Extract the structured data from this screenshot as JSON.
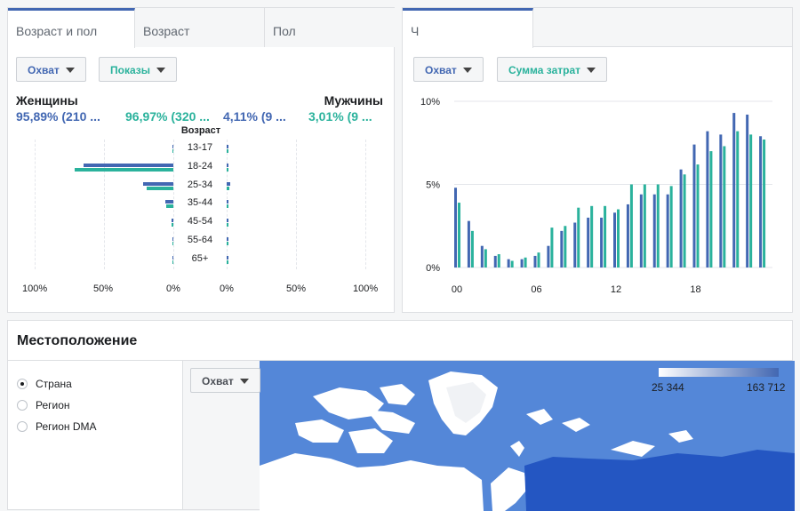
{
  "age_card": {
    "tabs": [
      "Возраст и пол",
      "Возраст",
      "Пол"
    ],
    "metric1": "Охват",
    "metric2": "Показы",
    "women_label": "Женщины",
    "men_label": "Мужчины",
    "women_reach": "95,89% (210 ...",
    "women_impr": "96,97% (320 ...",
    "men_reach": "4,11% (9 ...",
    "men_impr": "3,01% (9 ...",
    "age_header": "Возраст",
    "axis_left": [
      "100%",
      "50%",
      "0%"
    ],
    "axis_right": [
      "0%",
      "50%",
      "100%"
    ]
  },
  "hour_card": {
    "tab": "Ч",
    "metric1": "Охват",
    "metric2": "Сумма затрат",
    "y_ticks": [
      "10%",
      "5%",
      "0%"
    ],
    "x_ticks": [
      "00",
      "06",
      "12",
      "18"
    ]
  },
  "location": {
    "title": "Местоположение",
    "options": [
      "Страна",
      "Регион",
      "Регион DMA"
    ],
    "selected": "Страна",
    "metric": "Охват",
    "legend_min": "25 344",
    "legend_max": "163 712"
  },
  "colors": {
    "reach": "#4267b2",
    "secondary": "#2ab29c"
  },
  "chart_data": [
    {
      "type": "bar",
      "title": "",
      "xlabel": "Возраст",
      "categories": [
        "13-17",
        "18-24",
        "25-34",
        "35-44",
        "45-54",
        "55-64",
        "65+"
      ],
      "xlim": [
        -100,
        100
      ],
      "series": [
        {
          "name": "Охват",
          "group": "Женщины",
          "values": [
            0.2,
            65,
            21.5,
            6,
            1.5,
            0.5,
            0.3
          ]
        },
        {
          "name": "Показы",
          "group": "Женщины",
          "values": [
            0.2,
            71,
            19,
            5,
            1.3,
            0.5,
            0.3
          ]
        },
        {
          "name": "Охват",
          "group": "Мужчины",
          "values": [
            0.1,
            0.5,
            2.5,
            0.7,
            0.2,
            0.1,
            0.1
          ]
        },
        {
          "name": "Показы",
          "group": "Мужчины",
          "values": [
            0.1,
            0.4,
            1.8,
            0.5,
            0.2,
            0.1,
            0.1
          ]
        }
      ]
    },
    {
      "type": "bar",
      "title": "",
      "xlabel": "",
      "ylabel": "",
      "ylim": [
        0,
        10
      ],
      "x": [
        0,
        1,
        2,
        3,
        4,
        5,
        6,
        7,
        8,
        9,
        10,
        11,
        12,
        13,
        14,
        15,
        16,
        17,
        18,
        19,
        20,
        21,
        22,
        23
      ],
      "series": [
        {
          "name": "Охват",
          "values": [
            4.8,
            2.8,
            1.3,
            0.7,
            0.5,
            0.5,
            0.7,
            1.3,
            2.2,
            2.7,
            3.0,
            3.0,
            3.3,
            3.8,
            4.4,
            4.4,
            4.4,
            5.9,
            7.4,
            8.2,
            8.0,
            9.3,
            9.2,
            7.9
          ]
        },
        {
          "name": "Сумма затрат",
          "values": [
            3.9,
            2.2,
            1.1,
            0.8,
            0.4,
            0.6,
            0.9,
            2.4,
            2.5,
            3.6,
            3.7,
            3.7,
            3.5,
            5.0,
            5.0,
            5.0,
            4.9,
            5.6,
            6.2,
            7.0,
            7.3,
            8.2,
            8.0,
            7.7
          ]
        }
      ]
    }
  ]
}
